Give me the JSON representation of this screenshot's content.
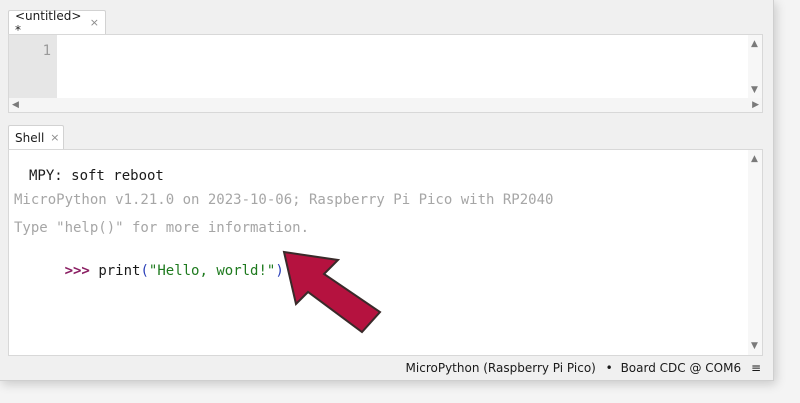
{
  "editor": {
    "tab_label": "<untitled> *",
    "tab_close": "×",
    "line_number": "1"
  },
  "shell": {
    "tab_label": "Shell",
    "tab_close": "×",
    "lines": {
      "l1": "MPY: soft reboot",
      "l2": "MicroPython v1.21.0 on 2023-10-06; Raspberry Pi Pico with RP2040",
      "l3": "Type \"help()\" for more information."
    },
    "prompt": ">>>",
    "command": {
      "func": "print",
      "open_paren": "(",
      "string": "\"Hello, world!\"",
      "close_paren": ")"
    }
  },
  "statusbar": {
    "interpreter": "MicroPython (Raspberry Pi Pico)",
    "separator": "•",
    "port": "Board CDC @ COM6",
    "menu_glyph": "≡"
  },
  "icons": {
    "pointer_arrow": "red-arrow-icon",
    "pointer_color": "#b5123f"
  }
}
